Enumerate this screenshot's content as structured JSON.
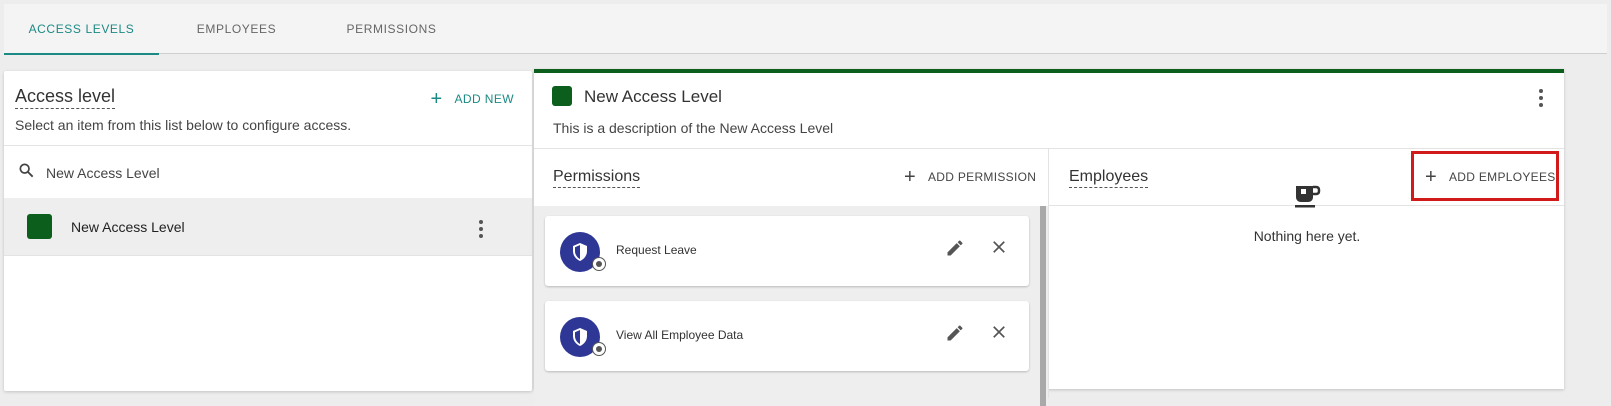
{
  "tabs": [
    {
      "label": "ACCESS LEVELS",
      "active": true
    },
    {
      "label": "EMPLOYEES",
      "active": false
    },
    {
      "label": "PERMISSIONS",
      "active": false
    }
  ],
  "left_panel": {
    "title": "Access level",
    "add_new_label": "ADD NEW",
    "subtitle": "Select an item from this list below to configure access.",
    "search": {
      "value": "New Access Level",
      "icon": "search-icon"
    },
    "items": [
      {
        "label": "New Access Level",
        "color": "#0b5e1c",
        "selected": true
      }
    ]
  },
  "detail": {
    "title": "New Access Level",
    "color": "#0b5e1c",
    "description": "This is a description of the New Access Level",
    "permissions": {
      "title": "Permissions",
      "add_label": "ADD PERMISSION",
      "items": [
        {
          "label": "Request Leave"
        },
        {
          "label": "View All Employee Data"
        }
      ]
    },
    "employees": {
      "title": "Employees",
      "add_label": "ADD EMPLOYEES",
      "empty_text": "Nothing here yet.",
      "empty_icon": "coffee-cup-icon"
    }
  },
  "colors": {
    "accent": "#1c8a84",
    "brand_green": "#0b5e1c",
    "highlight": "#d11a1a",
    "permission_icon": "#2f3796"
  }
}
